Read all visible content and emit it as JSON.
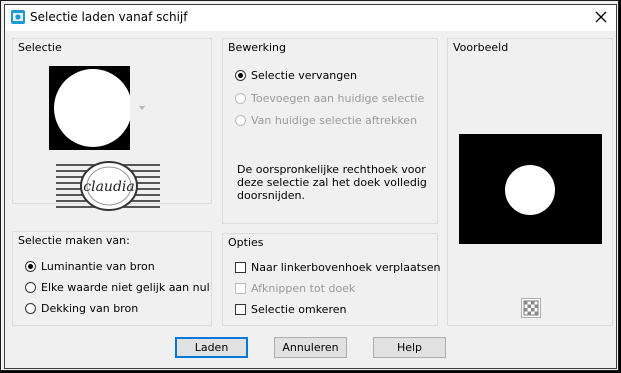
{
  "window": {
    "title": "Selectie laden vanaf schijf",
    "app_icon": "app-icon",
    "close_icon": "close-icon"
  },
  "groups": {
    "selectie": {
      "label": "Selectie"
    },
    "bewerking": {
      "label": "Bewerking",
      "options": [
        {
          "label": "Selectie vervangen",
          "selected": true,
          "enabled": true
        },
        {
          "label": "Toevoegen aan huidige selectie",
          "selected": false,
          "enabled": false
        },
        {
          "label": "Van huidige selectie aftrekken",
          "selected": false,
          "enabled": false
        }
      ],
      "description": "De oorspronkelijke rechthoek voor deze selectie zal het doek volledig doorsnijden."
    },
    "voorbeeld": {
      "label": "Voorbeeld",
      "transparency_icon": "transparency-icon"
    },
    "selectie_maken": {
      "label": "Selectie maken van:",
      "options": [
        {
          "label": "Luminantie van bron",
          "selected": true
        },
        {
          "label": "Elke waarde niet gelijk aan nul",
          "selected": false
        },
        {
          "label": "Dekking van bron",
          "selected": false
        }
      ]
    },
    "opties": {
      "label": "Opties",
      "checkboxes": [
        {
          "label": "Naar linkerbovenhoek verplaatsen",
          "checked": false,
          "enabled": true
        },
        {
          "label": "Afknippen tot doek",
          "checked": false,
          "enabled": false
        },
        {
          "label": "Selectie omkeren",
          "checked": false,
          "enabled": true
        }
      ]
    }
  },
  "watermark_text": "claudia",
  "buttons": {
    "load": "Laden",
    "cancel": "Annuleren",
    "help": "Help"
  },
  "colors": {
    "default_border": "#0078d7",
    "preview_bg": "#000000",
    "selection_fill": "#ffffff"
  }
}
